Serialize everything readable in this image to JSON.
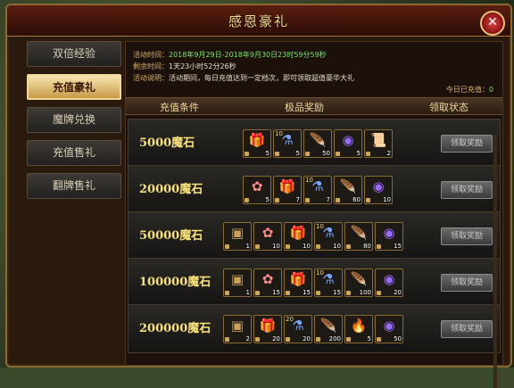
{
  "dialog": {
    "title": "感恩豪礼"
  },
  "sidebar": {
    "items": [
      {
        "label": "双倍经验",
        "active": false
      },
      {
        "label": "充值豪礼",
        "active": true
      },
      {
        "label": "魔牌兑换",
        "active": false
      },
      {
        "label": "充值售礼",
        "active": false
      },
      {
        "label": "翻牌售礼",
        "active": false
      }
    ]
  },
  "info": {
    "time_label": "活动时间：",
    "time_value": "2018年9月29日-2018年9月30日23时59分59秒",
    "remain_label": "剩余时间：",
    "remain_value": "1天23小时52分26秒",
    "desc_label": "活动说明：",
    "desc_value": "活动期间，每日充值达到一定档次，即可领取超值豪华大礼",
    "recharged_label": "今日已充值：",
    "recharged_value": "0"
  },
  "table": {
    "headers": {
      "condition": "充值条件",
      "reward": "极品奖励",
      "status": "领取状态"
    },
    "claim_label": "领取奖励",
    "rows": [
      {
        "condition": "5000魔石",
        "items": [
          {
            "icon": "gift-box",
            "count": "5"
          },
          {
            "icon": "exp-potion",
            "count": "5",
            "badge": "10"
          },
          {
            "icon": "feather",
            "count": "50"
          },
          {
            "icon": "exp-orb",
            "count": "5"
          },
          {
            "icon": "scroll",
            "count": "2"
          }
        ]
      },
      {
        "condition": "20000魔石",
        "items": [
          {
            "icon": "lotus",
            "count": "5"
          },
          {
            "icon": "gift-box",
            "count": "7"
          },
          {
            "icon": "exp-potion",
            "count": "7",
            "badge": "10"
          },
          {
            "icon": "feather",
            "count": "60"
          },
          {
            "icon": "exp-orb",
            "count": "10"
          }
        ]
      },
      {
        "condition": "50000魔石",
        "items": [
          {
            "icon": "treasure-chest",
            "count": "1"
          },
          {
            "icon": "lotus",
            "count": "10"
          },
          {
            "icon": "gift-box",
            "count": "10"
          },
          {
            "icon": "exp-potion",
            "count": "10",
            "badge": "10"
          },
          {
            "icon": "feather",
            "count": "80"
          },
          {
            "icon": "exp-orb",
            "count": "15"
          }
        ]
      },
      {
        "condition": "100000魔石",
        "items": [
          {
            "icon": "treasure-chest",
            "count": "1"
          },
          {
            "icon": "lotus",
            "count": "15"
          },
          {
            "icon": "gift-box",
            "count": "15"
          },
          {
            "icon": "exp-potion",
            "count": "15",
            "badge": "10"
          },
          {
            "icon": "feather",
            "count": "100"
          },
          {
            "icon": "exp-orb",
            "count": "20"
          }
        ]
      },
      {
        "condition": "200000魔石",
        "items": [
          {
            "icon": "treasure-chest",
            "count": "2"
          },
          {
            "icon": "gift-box",
            "count": "20"
          },
          {
            "icon": "exp-potion",
            "count": "20",
            "badge": "20"
          },
          {
            "icon": "feather",
            "count": "200"
          },
          {
            "icon": "flame-feather",
            "count": "5"
          },
          {
            "icon": "exp-orb",
            "count": "50"
          }
        ]
      }
    ]
  }
}
